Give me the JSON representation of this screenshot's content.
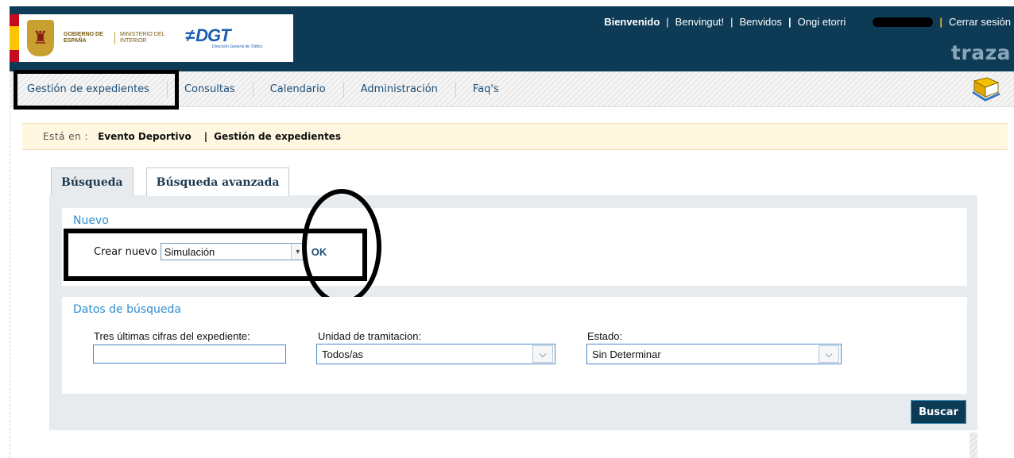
{
  "header": {
    "gov_text": "GOBIERNO DE ESPAÑA",
    "ministry_text": "MINISTERIO DEL INTERIOR",
    "dgt_logo": "DGT",
    "dgt_sub": "Dirección General de Tráfico",
    "welcome": "Bienvenido",
    "greetings": [
      "Benvingut!",
      "Benvidos",
      "Ongi etorri"
    ],
    "logout": "Cerrar sesión",
    "brand": "traza"
  },
  "nav": {
    "items": [
      "Gestión de expedientes",
      "Consultas",
      "Calendario",
      "Administración",
      "Faq's"
    ]
  },
  "breadcrumb": {
    "label": "Está en :",
    "item1": "Evento Deportivo",
    "separator": "|",
    "item2": "Gestión de expedientes"
  },
  "tabs": [
    "Búsqueda",
    "Búsqueda avanzada"
  ],
  "nuevo": {
    "title": "Nuevo",
    "crear_label": "Crear nuevo",
    "selected": "Simulación",
    "ok": "OK"
  },
  "datos": {
    "title": "Datos de búsqueda",
    "field1_label": "Tres últimas cifras del expediente:",
    "field1_value": "",
    "field2_label": "Unidad de tramitacion:",
    "field2_value": "Todos/as",
    "field3_label": "Estado:",
    "field3_value": "Sin Determinar"
  },
  "buscar": "Buscar",
  "colors": {
    "header_bg": "#0d3a55",
    "link": "#1d4f78",
    "section_title": "#2c8fd0"
  }
}
